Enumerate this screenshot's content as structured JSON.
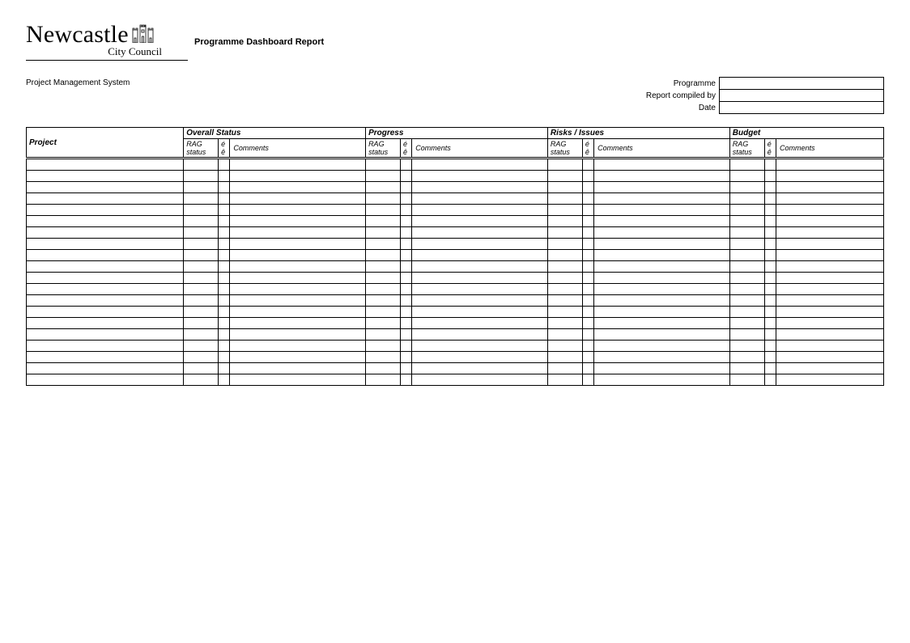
{
  "logo": {
    "name": "Newcastle",
    "sub": "City Council"
  },
  "header": {
    "report_title": "Programme Dashboard Report",
    "system_name": "Project Management System"
  },
  "meta": {
    "labels": {
      "programme": "Programme",
      "compiled_by": "Report compiled by",
      "date": "Date"
    },
    "values": {
      "programme": "",
      "compiled_by": "",
      "date": ""
    }
  },
  "table": {
    "project_header": "Project",
    "groups": {
      "overall": "Overall Status",
      "progress": "Progress",
      "risks": "Risks / Issues",
      "budget": "Budget"
    },
    "sub": {
      "rag": "RAG status",
      "e1": "é",
      "e2": "ê",
      "comments": "Comments"
    },
    "row_count": 20
  }
}
